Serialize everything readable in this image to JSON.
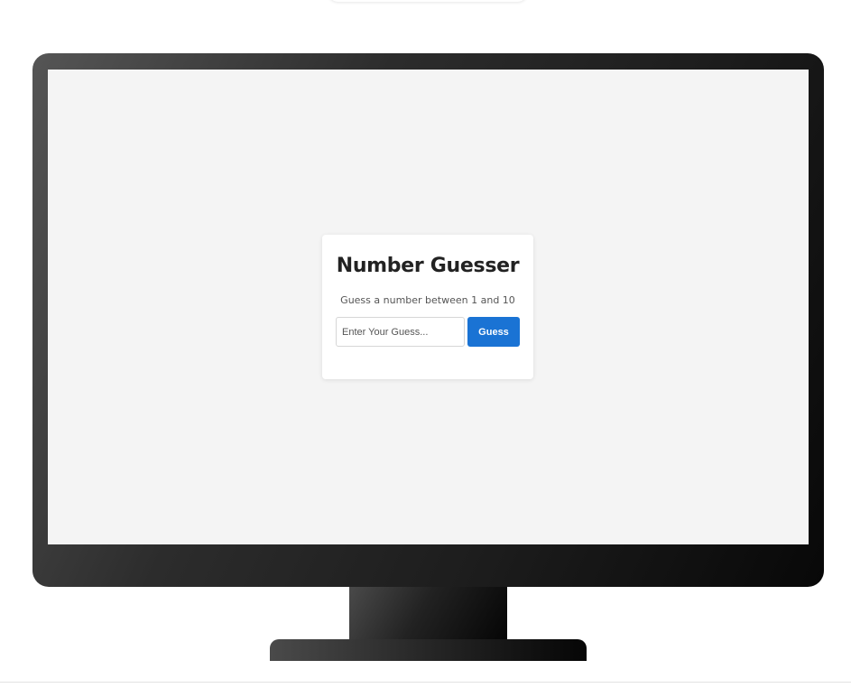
{
  "app": {
    "title": "Number Guesser",
    "subtitle": "Guess a number between 1 and 10"
  },
  "guess_form": {
    "input_value": "",
    "input_placeholder": "Enter Your Guess...",
    "button_label": "Guess"
  },
  "colors": {
    "page_background": "#ffffff",
    "screen_background": "#f4f4f4",
    "card_background": "#ffffff",
    "button_accent": "#1a73d4",
    "monitor_frame": "#1d1d1d"
  },
  "icons": {
    "monitor": "desktop-monitor-frame"
  }
}
